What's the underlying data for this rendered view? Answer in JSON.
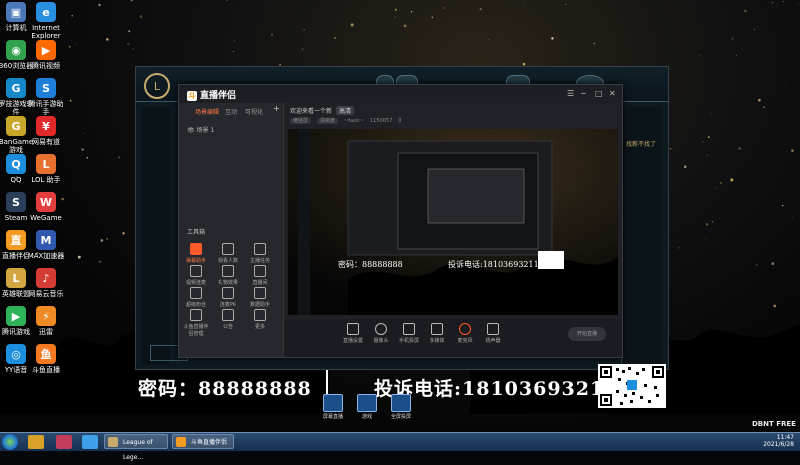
{
  "desktop_icons": [
    {
      "label": "计算机",
      "icon": "computer-icon",
      "color": "#4a78b8",
      "glyph": "▣"
    },
    {
      "label": "Internet Explorer",
      "icon": "ie-icon",
      "color": "#2a8fe0",
      "glyph": "e"
    },
    {
      "label": "360浏览器",
      "icon": "browser-360-icon",
      "color": "#31a24c",
      "glyph": "◉"
    },
    {
      "label": "腾讯视频",
      "icon": "tencent-video-icon",
      "color": "#ff6a00",
      "glyph": "▶"
    },
    {
      "label": "罗技游戏软件",
      "icon": "logitech-g-icon",
      "color": "#1488c9",
      "glyph": "G"
    },
    {
      "label": "腾讯手游助手",
      "icon": "tencent-assistant-icon",
      "color": "#1e7fd8",
      "glyph": "S"
    },
    {
      "label": "BanGame游戏",
      "icon": "game-icon",
      "color": "#c8a82b",
      "glyph": "G"
    },
    {
      "label": "网易有道",
      "icon": "youdao-icon",
      "color": "#e02a2a",
      "glyph": "¥"
    },
    {
      "label": "QQ",
      "icon": "qq-icon",
      "color": "#1c8ede",
      "glyph": "Q"
    },
    {
      "label": "LOL 助手",
      "icon": "lol-helper-icon",
      "color": "#e6712e",
      "glyph": "L"
    },
    {
      "label": "Steam",
      "icon": "steam-icon",
      "color": "#2a3f5a",
      "glyph": "S"
    },
    {
      "label": "WeGame",
      "icon": "wegame-icon",
      "color": "#e23e3e",
      "glyph": "W"
    },
    {
      "label": "直播伴侣",
      "icon": "live-companion-icon",
      "color": "#f59a23",
      "glyph": "直"
    },
    {
      "label": "MAX加速器",
      "icon": "max-accelerator-icon",
      "color": "#3159b0",
      "glyph": "M"
    },
    {
      "label": "英雄联盟",
      "icon": "lol-icon",
      "color": "#d4a642",
      "glyph": "L"
    },
    {
      "label": "网易云音乐",
      "icon": "netease-music-icon",
      "color": "#d43c33",
      "glyph": "♪"
    },
    {
      "label": "腾讯游戏",
      "icon": "tencent-games-icon",
      "color": "#2eb35a",
      "glyph": "▶"
    },
    {
      "label": "迅雷",
      "icon": "thunder-icon",
      "color": "#f08a24",
      "glyph": "⚡"
    },
    {
      "label": "YY语音",
      "icon": "yy-icon",
      "color": "#1c8ede",
      "glyph": "◎"
    },
    {
      "label": "斗鱼直播",
      "icon": "douyu-icon",
      "color": "#f57921",
      "glyph": "鱼"
    }
  ],
  "game_window": {
    "logo": "L",
    "tag": "找新不找了"
  },
  "obs": {
    "brand": "直播伴侣",
    "brand_mark": "斗",
    "tabs": [
      "场景编辑",
      "互动",
      "可视化"
    ],
    "scene_name": "场景 1",
    "tools_title": "工具箱",
    "tools": [
      {
        "label": "弹幕助手",
        "hot": true
      },
      {
        "label": "观看人数",
        "hot": false
      },
      {
        "label": "主播任务",
        "hot": false
      },
      {
        "label": "视频连麦",
        "hot": false
      },
      {
        "label": "礼物效果",
        "hot": false
      },
      {
        "label": "直播间",
        "hot": false
      },
      {
        "label": "超级粉丝",
        "hot": false
      },
      {
        "label": "连麦PK",
        "hot": false
      },
      {
        "label": "数据助手",
        "hot": false
      },
      {
        "label": "斗鱼直播伴侣管理",
        "hot": false
      },
      {
        "label": "公告",
        "hot": false
      },
      {
        "label": "更多",
        "hot": false
      }
    ],
    "canvas_title": "欢迎来看一个新",
    "canvas_tag": "高清",
    "stats": [
      "横竖屏",
      "清晰度",
      "~fasic~",
      "1150657",
      "0"
    ],
    "bottom_buttons": [
      "直播设置",
      "摄像头",
      "手机投屏",
      "多媒体",
      "麦克风",
      "扬声器"
    ],
    "start_label": "开始直播",
    "window_controls": [
      "☰",
      "─",
      "□",
      "✕"
    ]
  },
  "overlay": {
    "password": "密码：88888888",
    "phone": "投诉电话:18103693211",
    "float_buttons": [
      "屏幕直播",
      "游戏",
      "全屏投屏"
    ]
  },
  "watermark": "DBNT FREE",
  "taskbar": {
    "tasks": [
      {
        "label": "League of Lege...",
        "color": "#c8aa6e"
      },
      {
        "label": "斗鱼直播伴侣",
        "color": "#f59a23"
      }
    ],
    "time": "11:47",
    "date": "2021/6/28"
  },
  "colors": {
    "accent": "#ff7a45",
    "panel": "#23252b",
    "taskbar": "#2b4a70"
  }
}
